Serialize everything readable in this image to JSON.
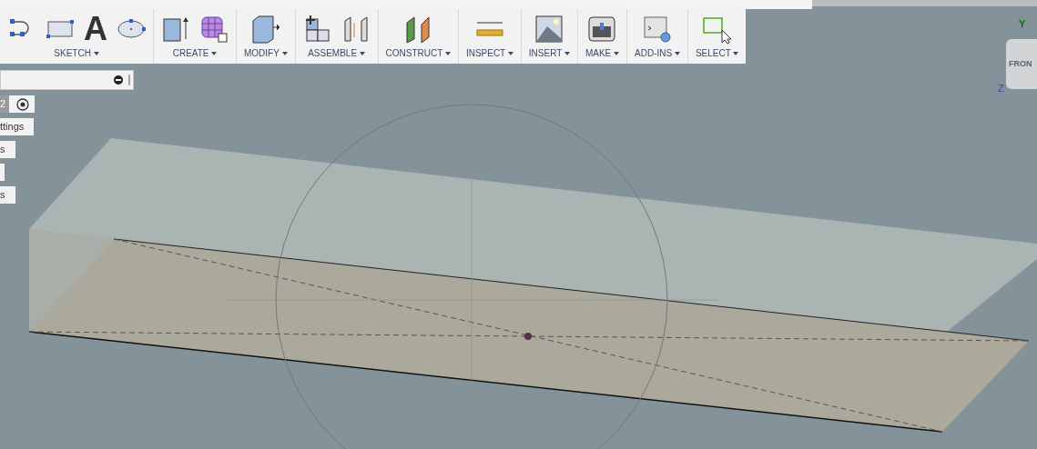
{
  "toolbar": {
    "groups": [
      {
        "label": "SKETCH",
        "text_tool_glyph": "A"
      },
      {
        "label": "CREATE"
      },
      {
        "label": "MODIFY"
      },
      {
        "label": "ASSEMBLE"
      },
      {
        "label": "CONSTRUCT"
      },
      {
        "label": "INSPECT"
      },
      {
        "label": "INSERT"
      },
      {
        "label": "MAKE"
      },
      {
        "label": "ADD-INS"
      },
      {
        "label": "SELECT"
      }
    ]
  },
  "browser_panel": {
    "items": [
      {
        "kind": "number",
        "text": "2"
      },
      {
        "kind": "text",
        "text": "ttings"
      },
      {
        "kind": "text",
        "text": "s"
      },
      {
        "kind": "blank"
      },
      {
        "kind": "text",
        "text": "s"
      }
    ]
  },
  "view_cube": {
    "face": "FRON",
    "axes": [
      "Y",
      "Z"
    ]
  }
}
